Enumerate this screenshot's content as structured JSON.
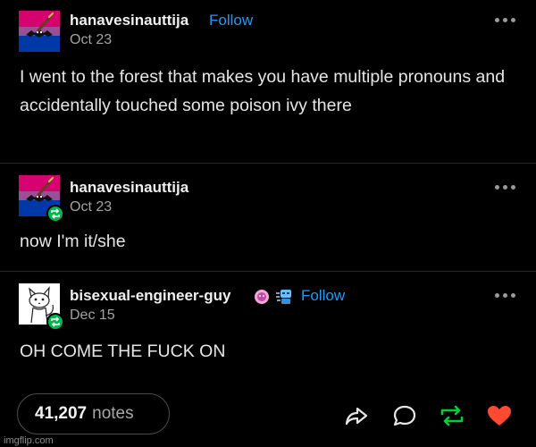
{
  "posts": [
    {
      "username": "hanavesinauttija",
      "follow_label": "Follow",
      "date": "Oct 23",
      "body": "I went to the forest that makes you have multiple pronouns and accidentally touched some poison ivy there",
      "avatar": "bisexual-flag-bat-avatar"
    },
    {
      "username": "hanavesinauttija",
      "date": "Oct 23",
      "body": "now I'm it/she",
      "avatar": "bisexual-flag-bat-avatar",
      "reblog_badge": "reblog-icon"
    },
    {
      "username": "bisexual-engineer-guy",
      "follow_label": "Follow",
      "date": "Dec 15",
      "body": "OH COME THE FUCK ON",
      "avatar": "cat-sketch-avatar",
      "reblog_badge": "reblog-icon",
      "user_badges": [
        "pink-blob-badge-icon",
        "robot-badge-icon"
      ]
    }
  ],
  "footer": {
    "notes_count": "41,207",
    "notes_label": "notes",
    "actions": [
      "share-icon",
      "reply-icon",
      "reblog-icon",
      "like-icon"
    ],
    "like_color": "#ff4930",
    "reblog_color": "#00cf35"
  },
  "watermark": "imgflip.com",
  "colors": {
    "background": "#000000",
    "link": "#1e9bff",
    "reblog_badge": "#00b84d"
  }
}
